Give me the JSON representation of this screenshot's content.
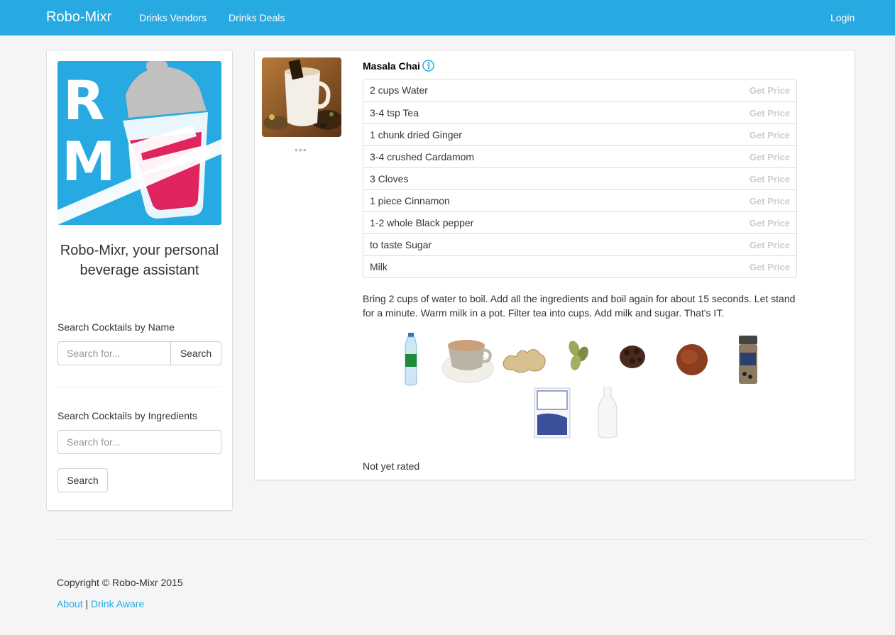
{
  "navbar": {
    "brand": "Robo-Mixr",
    "links": [
      "Drinks Vendors",
      "Drinks Deals"
    ],
    "login": "Login"
  },
  "sidebar": {
    "logo_letters": [
      "R",
      "M"
    ],
    "tagline": "Robo-Mixr, your personal beverage assistant",
    "search_name": {
      "label": "Search Cocktails by Name",
      "placeholder": "Search for...",
      "button": "Search"
    },
    "search_ingredients": {
      "label": "Search Cocktails by Ingredients",
      "placeholder": "Search for...",
      "button": "Search"
    }
  },
  "drink": {
    "title": "Masala Chai",
    "more": "•••",
    "ingredients": [
      {
        "name": "2 cups Water",
        "price": "Get Price"
      },
      {
        "name": "3-4 tsp Tea",
        "price": "Get Price"
      },
      {
        "name": "1 chunk dried Ginger",
        "price": "Get Price"
      },
      {
        "name": "3-4 crushed Cardamom",
        "price": "Get Price"
      },
      {
        "name": "3 Cloves",
        "price": "Get Price"
      },
      {
        "name": "1 piece Cinnamon",
        "price": "Get Price"
      },
      {
        "name": "1-2 whole Black pepper",
        "price": "Get Price"
      },
      {
        "name": "to taste Sugar",
        "price": "Get Price"
      },
      {
        "name": "Milk",
        "price": "Get Price"
      }
    ],
    "instructions": "Bring 2 cups of water to boil. Add all the ingredients and boil again for about 15 seconds. Let stand for a minute. Warm milk in a pot. Filter tea into cups. Add milk and sugar. That's IT.",
    "rating": "Not yet rated"
  },
  "footer": {
    "copyright": "Copyright © Robo-Mixr 2015",
    "about": "About",
    "separator": "|",
    "drink_aware": "Drink Aware"
  },
  "colors": {
    "brand": "#27aae1",
    "logo_pink": "#e0245e",
    "logo_grey": "#c0c0c0"
  }
}
